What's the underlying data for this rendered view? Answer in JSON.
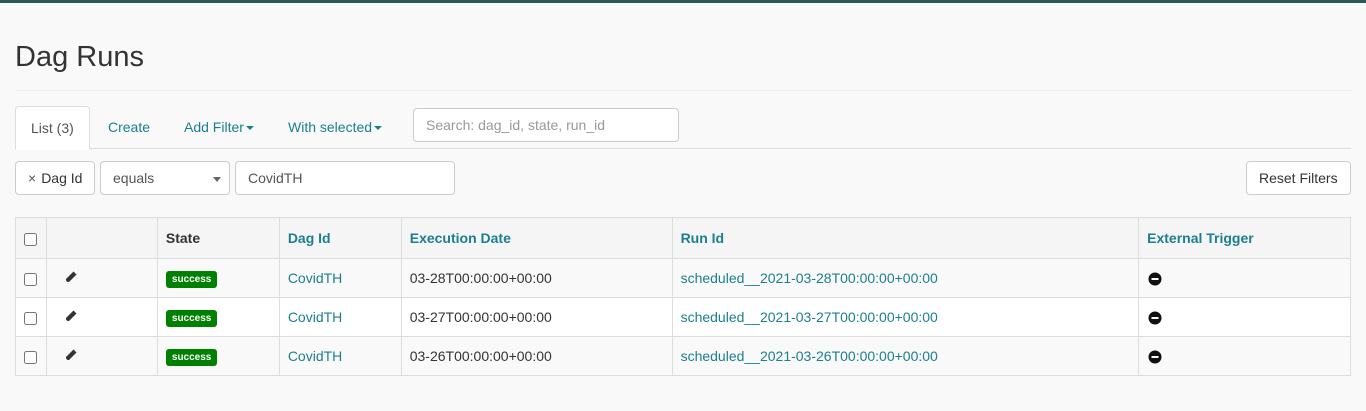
{
  "page": {
    "title": "Dag Runs"
  },
  "tabs": [
    {
      "label": "List (3)",
      "active": true
    },
    {
      "label": "Create"
    },
    {
      "label": "Add Filter"
    },
    {
      "label": "With selected"
    }
  ],
  "search": {
    "placeholder": "Search: dag_id, state, run_id"
  },
  "filter": {
    "column_label": "Dag Id",
    "remove_glyph": "×",
    "operator": "equals",
    "value": "CovidTH",
    "reset_label": "Reset Filters"
  },
  "table": {
    "columns": [
      "",
      "",
      "State",
      "Dag Id",
      "Execution Date",
      "Run Id",
      "External Trigger"
    ],
    "rows": [
      {
        "state": "success",
        "dag_id": "CovidTH",
        "execution_date": "03-28T00:00:00+00:00",
        "run_id": "scheduled__2021-03-28T00:00:00+00:00",
        "external_trigger_icon": "minus-circle-icon"
      },
      {
        "state": "success",
        "dag_id": "CovidTH",
        "execution_date": "03-27T00:00:00+00:00",
        "run_id": "scheduled__2021-03-27T00:00:00+00:00",
        "external_trigger_icon": "minus-circle-icon"
      },
      {
        "state": "success",
        "dag_id": "CovidTH",
        "execution_date": "03-26T00:00:00+00:00",
        "run_id": "scheduled__2021-03-26T00:00:00+00:00",
        "external_trigger_icon": "minus-circle-icon"
      }
    ]
  },
  "colors": {
    "link": "#1b7f8f",
    "success_badge": "#008000",
    "header_bar": "#2a5a54"
  }
}
